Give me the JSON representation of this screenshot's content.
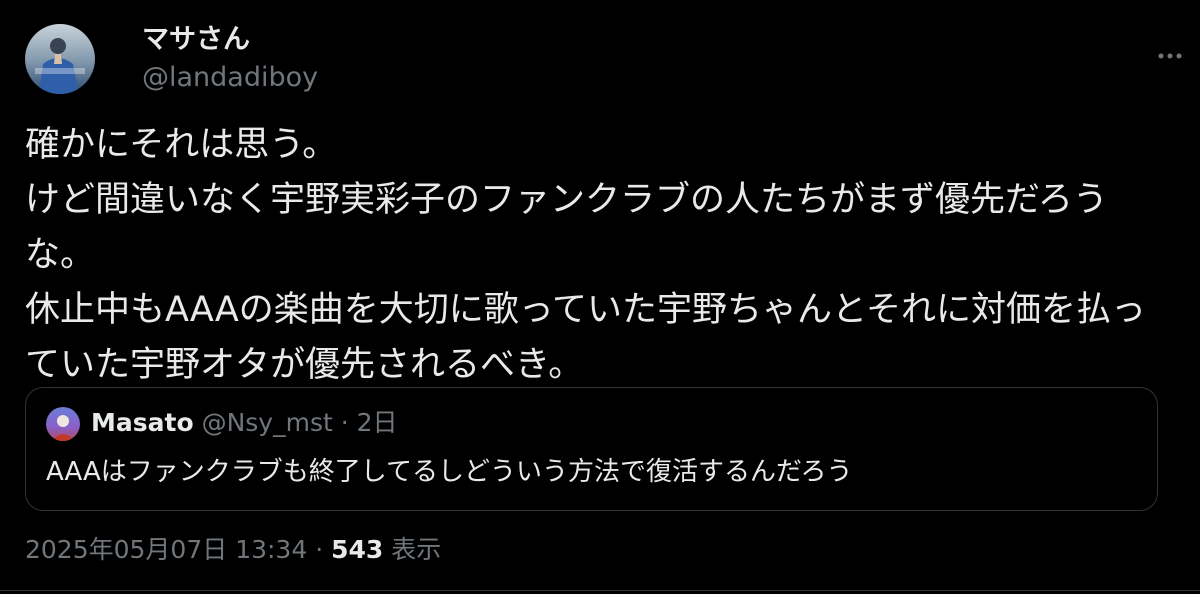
{
  "author": {
    "display_name": "マサさん",
    "handle": "@landadiboy"
  },
  "tweet": {
    "text": "確かにそれは思う。\nけど間違いなく宇野実彩子のファンクラブの人たちがまず優先だろうな。\n休止中もAAAの楽曲を大切に歌っていた宇野ちゃんとそれに対価を払っていた宇野オタが優先されるべき。"
  },
  "quoted_tweet": {
    "display_name": "Masato",
    "handle": "@Nsy_mst",
    "separator": "·",
    "time": "2日",
    "text": "AAAはファンクラブも終了してるしどういう方法で復活するんだろう"
  },
  "meta": {
    "timestamp": "2025年05月07日 13:34",
    "separator": "·",
    "views_count": "543",
    "views_label": "表示"
  },
  "icons": {
    "more": "more-horizontal-icon"
  },
  "colors": {
    "background": "#000000",
    "text_primary": "#e7e9ea",
    "text_secondary": "#71767b",
    "border": "#2f3336"
  }
}
